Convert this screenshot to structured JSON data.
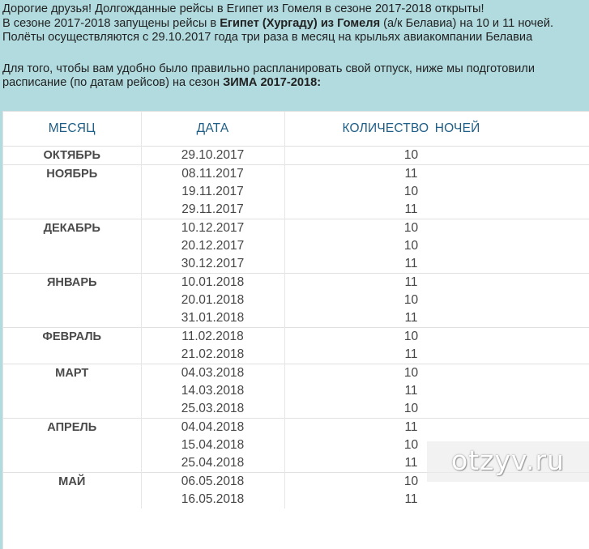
{
  "intro": {
    "line1": "Дорогие друзья! Долгожданные рейсы в Египет из Гомеля в сезоне 2017-2018 открыты!",
    "line2_pre": "В сезоне 2017-2018 запущены рейсы в ",
    "line2_bold": "Египет (Хургаду) из Гомеля",
    "line2_post": " (а/к Белавиа) на 10 и 11 ночей.",
    "line3": "Полёты осуществляются с 29.10.2017 года три раза в месяц на крыльях авиакомпании Белавиа",
    "line4": "Для того, чтобы вам удобно было правильно распланировать свой отпуск, ниже мы подготовили",
    "line5_pre": "расписание (по датам рейсов) на сезон ",
    "line5_bold": "ЗИМА 2017-2018:"
  },
  "table": {
    "headers": {
      "month": "МЕСЯЦ",
      "date": "ДАТА",
      "nights": "КОЛИЧЕСТВО  НОЧЕЙ"
    },
    "rows": [
      {
        "month": "ОКТЯБРЬ",
        "dates": [
          "29.10.2017"
        ],
        "nights": [
          "10"
        ]
      },
      {
        "month": "НОЯБРЬ",
        "dates": [
          "08.11.2017",
          "19.11.2017",
          "29.11.2017"
        ],
        "nights": [
          "11",
          "10",
          "11"
        ]
      },
      {
        "month": "ДЕКАБРЬ",
        "dates": [
          "10.12.2017",
          "20.12.2017",
          "30.12.2017"
        ],
        "nights": [
          "10",
          "10",
          "11"
        ]
      },
      {
        "month": "ЯНВАРЬ",
        "dates": [
          "10.01.2018",
          "20.01.2018",
          "31.01.2018"
        ],
        "nights": [
          "11",
          "10",
          "11"
        ]
      },
      {
        "month": "ФЕВРАЛЬ",
        "dates": [
          "11.02.2018",
          "21.02.2018"
        ],
        "nights": [
          "10",
          "11"
        ]
      },
      {
        "month": "МАРТ",
        "dates": [
          "04.03.2018",
          "14.03.2018",
          "25.03.2018"
        ],
        "nights": [
          "10",
          "11",
          "10"
        ]
      },
      {
        "month": "АПРЕЛЬ",
        "dates": [
          "04.04.2018",
          "15.04.2018",
          "25.04.2018"
        ],
        "nights": [
          "11",
          "10",
          "11"
        ]
      },
      {
        "month": "МАЙ",
        "dates": [
          "06.05.2018",
          "16.05.2018"
        ],
        "nights": [
          "10",
          "11"
        ]
      }
    ]
  },
  "watermark": {
    "text": "otzyv.ru"
  }
}
